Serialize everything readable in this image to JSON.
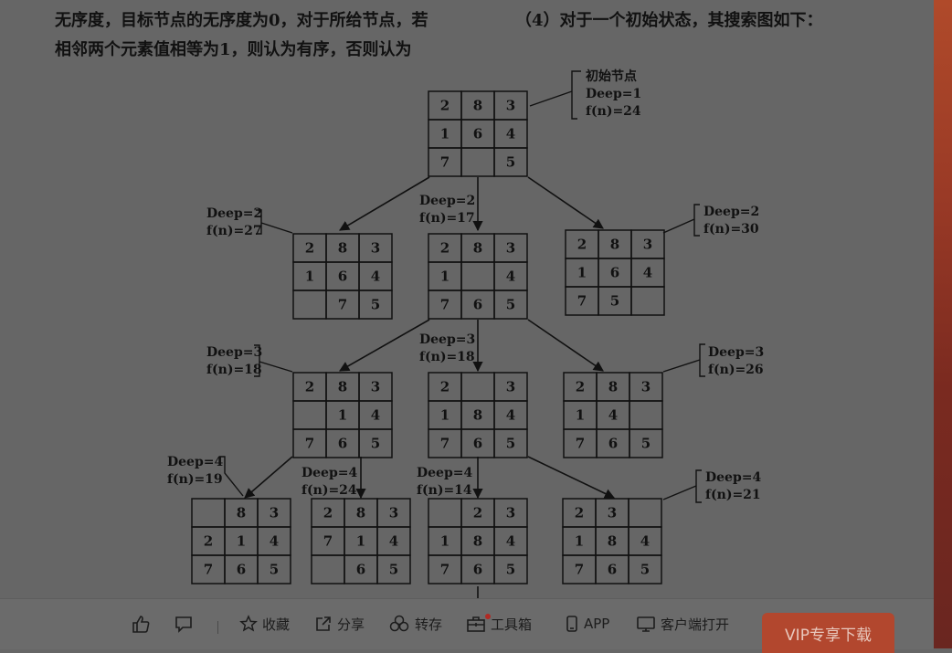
{
  "text_left_line1": "无序度，目标节点的无序度为0，对于所给节点，若",
  "text_left_line2": "相邻两个元素值相等为1，则认为有序，否则认为",
  "text_right_line1": "（4）对于一个初始状态，其搜索图如下：",
  "colors": {
    "page": "#666666",
    "ink": "#111111",
    "vip": "#b2472e"
  },
  "nodes": [
    {
      "id": "root",
      "grid": [
        [
          "2",
          "8",
          "3"
        ],
        [
          "1",
          "6",
          "4"
        ],
        [
          "7",
          "",
          "5"
        ]
      ]
    },
    {
      "id": "d2-left",
      "grid": [
        [
          "2",
          "8",
          "3"
        ],
        [
          "1",
          "6",
          "4"
        ],
        [
          "",
          "7",
          "5"
        ]
      ]
    },
    {
      "id": "d2-mid",
      "grid": [
        [
          "2",
          "8",
          "3"
        ],
        [
          "1",
          "",
          "4"
        ],
        [
          "7",
          "6",
          "5"
        ]
      ]
    },
    {
      "id": "d2-right",
      "grid": [
        [
          "2",
          "8",
          "3"
        ],
        [
          "1",
          "6",
          "4"
        ],
        [
          "7",
          "5",
          ""
        ]
      ]
    },
    {
      "id": "d3-left",
      "grid": [
        [
          "2",
          "8",
          "3"
        ],
        [
          "",
          "1",
          "4"
        ],
        [
          "7",
          "6",
          "5"
        ]
      ]
    },
    {
      "id": "d3-mid",
      "grid": [
        [
          "2",
          "",
          "3"
        ],
        [
          "1",
          "8",
          "4"
        ],
        [
          "7",
          "6",
          "5"
        ]
      ]
    },
    {
      "id": "d3-right",
      "grid": [
        [
          "2",
          "8",
          "3"
        ],
        [
          "1",
          "4",
          ""
        ],
        [
          "7",
          "6",
          "5"
        ]
      ]
    },
    {
      "id": "d4-a",
      "grid": [
        [
          "",
          "8",
          "3"
        ],
        [
          "2",
          "1",
          "4"
        ],
        [
          "7",
          "6",
          "5"
        ]
      ]
    },
    {
      "id": "d4-b",
      "grid": [
        [
          "2",
          "8",
          "3"
        ],
        [
          "7",
          "1",
          "4"
        ],
        [
          "",
          "6",
          "5"
        ]
      ]
    },
    {
      "id": "d4-c",
      "grid": [
        [
          "",
          "2",
          "3"
        ],
        [
          "1",
          "8",
          "4"
        ],
        [
          "7",
          "6",
          "5"
        ]
      ]
    },
    {
      "id": "d4-d",
      "grid": [
        [
          "2",
          "3",
          ""
        ],
        [
          "1",
          "8",
          "4"
        ],
        [
          "7",
          "6",
          "5"
        ]
      ]
    }
  ],
  "labels": [
    {
      "id": "lab-root",
      "lines": [
        "初始节点",
        "Deep=1",
        "f(n)=24"
      ]
    },
    {
      "id": "lab-d2-left",
      "lines": [
        "Deep=2",
        "f(n)=27"
      ]
    },
    {
      "id": "lab-d2-mid",
      "lines": [
        "Deep=2",
        "f(n)=17"
      ]
    },
    {
      "id": "lab-d2-right",
      "lines": [
        "Deep=2",
        "f(n)=30"
      ]
    },
    {
      "id": "lab-d3-left",
      "lines": [
        "Deep=3",
        "f(n)=18"
      ]
    },
    {
      "id": "lab-d3-mid",
      "lines": [
        "Deep=3",
        "f(n)=18"
      ]
    },
    {
      "id": "lab-d3-right",
      "lines": [
        "Deep=3",
        "f(n)=26"
      ]
    },
    {
      "id": "lab-d4-a",
      "lines": [
        "Deep=4",
        "f(n)=19"
      ]
    },
    {
      "id": "lab-d4-b",
      "lines": [
        "Deep=4",
        "f(n)=24"
      ]
    },
    {
      "id": "lab-d4-c",
      "lines": [
        "Deep=4",
        "f(n)=14"
      ]
    },
    {
      "id": "lab-d4-d",
      "lines": [
        "Deep=4",
        "f(n)=21"
      ]
    }
  ],
  "toolbar": {
    "like_icon": "thumbs-up-icon",
    "comment_icon": "comment-icon",
    "collect": "收藏",
    "share": "分享",
    "repost": "转存",
    "toolbox": "工具箱",
    "app": "APP",
    "client_open": "客户端打开",
    "vip_download": "VIP专享下载"
  }
}
